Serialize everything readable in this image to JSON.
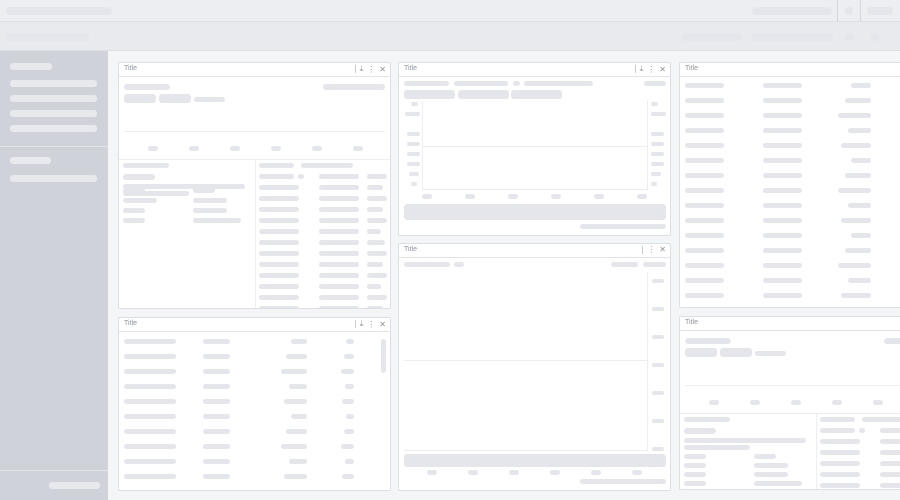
{
  "panels": [
    {
      "title": "Title",
      "icons": [
        "download-icon",
        "more-vertical-icon",
        "close-icon"
      ]
    },
    {
      "title": "Title",
      "icons": [
        "download-icon",
        "more-vertical-icon",
        "close-icon"
      ]
    },
    {
      "title": "Title",
      "icons": [
        "download-icon",
        "more-vertical-icon",
        "close-icon"
      ]
    },
    {
      "title": "Title",
      "icons": [
        "more-vertical-icon",
        "close-icon"
      ]
    },
    {
      "title": "Title",
      "icons": []
    },
    {
      "title": "Title",
      "icons": []
    }
  ],
  "icon_glyphs": {
    "download": "⤓",
    "more": "⋮",
    "close": "✕"
  },
  "colors": {
    "background": "#f4f5f7",
    "sidebar": "#cfd2d9",
    "skeleton": "#e4e6eb",
    "panel": "#ffffff"
  }
}
